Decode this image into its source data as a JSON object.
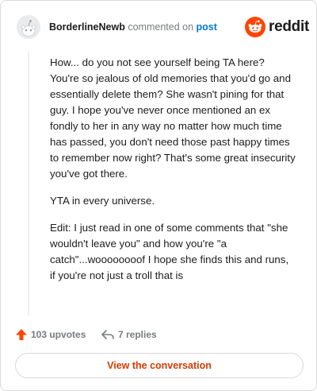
{
  "comment": {
    "username": "BorderlineNewb",
    "commented_text": "commented on",
    "post_link": "post",
    "paragraphs": [
      "How... do you not see yourself being TA here? You're so jealous of old memories that you'd go and essentially delete them? She wasn't pining for that guy. I hope you've never once mentioned an ex fondly to her in any way no matter how much time has passed, you don't need those past happy times to remember now right? That's some great insecurity you've got there.",
      "YTA in every universe.",
      "Edit: I just read in one of some comments that \"she wouldn't leave you\" and how you're \"a catch\"...woooooooof I hope she finds this and runs, if you're not just a troll that is"
    ]
  },
  "logo": {
    "wordmark": "reddit"
  },
  "actions": {
    "upvotes_label": "103 upvotes",
    "replies_label": "7 replies"
  },
  "cta": {
    "label": "View the conversation"
  },
  "colors": {
    "brand": "#ff4500",
    "cta_text": "#d93a00",
    "link": "#0079d3",
    "muted": "#787c7e"
  }
}
